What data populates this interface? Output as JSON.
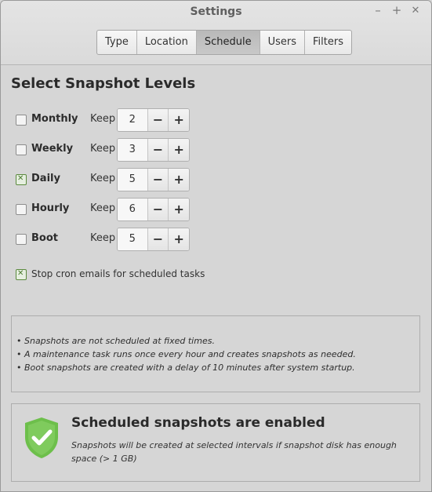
{
  "window": {
    "title": "Settings",
    "minimize": "–",
    "maximize": "+",
    "close": "✕"
  },
  "tabs": [
    {
      "label": "Type",
      "active": false
    },
    {
      "label": "Location",
      "active": false
    },
    {
      "label": "Schedule",
      "active": true
    },
    {
      "label": "Users",
      "active": false
    },
    {
      "label": "Filters",
      "active": false
    }
  ],
  "heading": "Select Snapshot Levels",
  "keep_label": "Keep",
  "levels": [
    {
      "label": "Monthly",
      "checked": false,
      "keep": "2"
    },
    {
      "label": "Weekly",
      "checked": false,
      "keep": "3"
    },
    {
      "label": "Daily",
      "checked": true,
      "keep": "5"
    },
    {
      "label": "Hourly",
      "checked": false,
      "keep": "6"
    },
    {
      "label": "Boot",
      "checked": false,
      "keep": "5"
    }
  ],
  "spin": {
    "minus": "−",
    "plus": "+"
  },
  "cron": {
    "label": "Stop cron emails for scheduled tasks",
    "checked": true
  },
  "info": [
    "• Snapshots are not scheduled at fixed times.",
    "• A maintenance task runs once every hour and creates snapshots as needed.",
    "• Boot snapshots are created with a delay of 10 minutes after system startup."
  ],
  "status": {
    "title": "Scheduled snapshots are enabled",
    "message": "Snapshots will be created at selected intervals if snapshot disk has enough space (> 1 GB)",
    "icon": "shield-check-icon",
    "icon_color": "#6dbf4b"
  }
}
